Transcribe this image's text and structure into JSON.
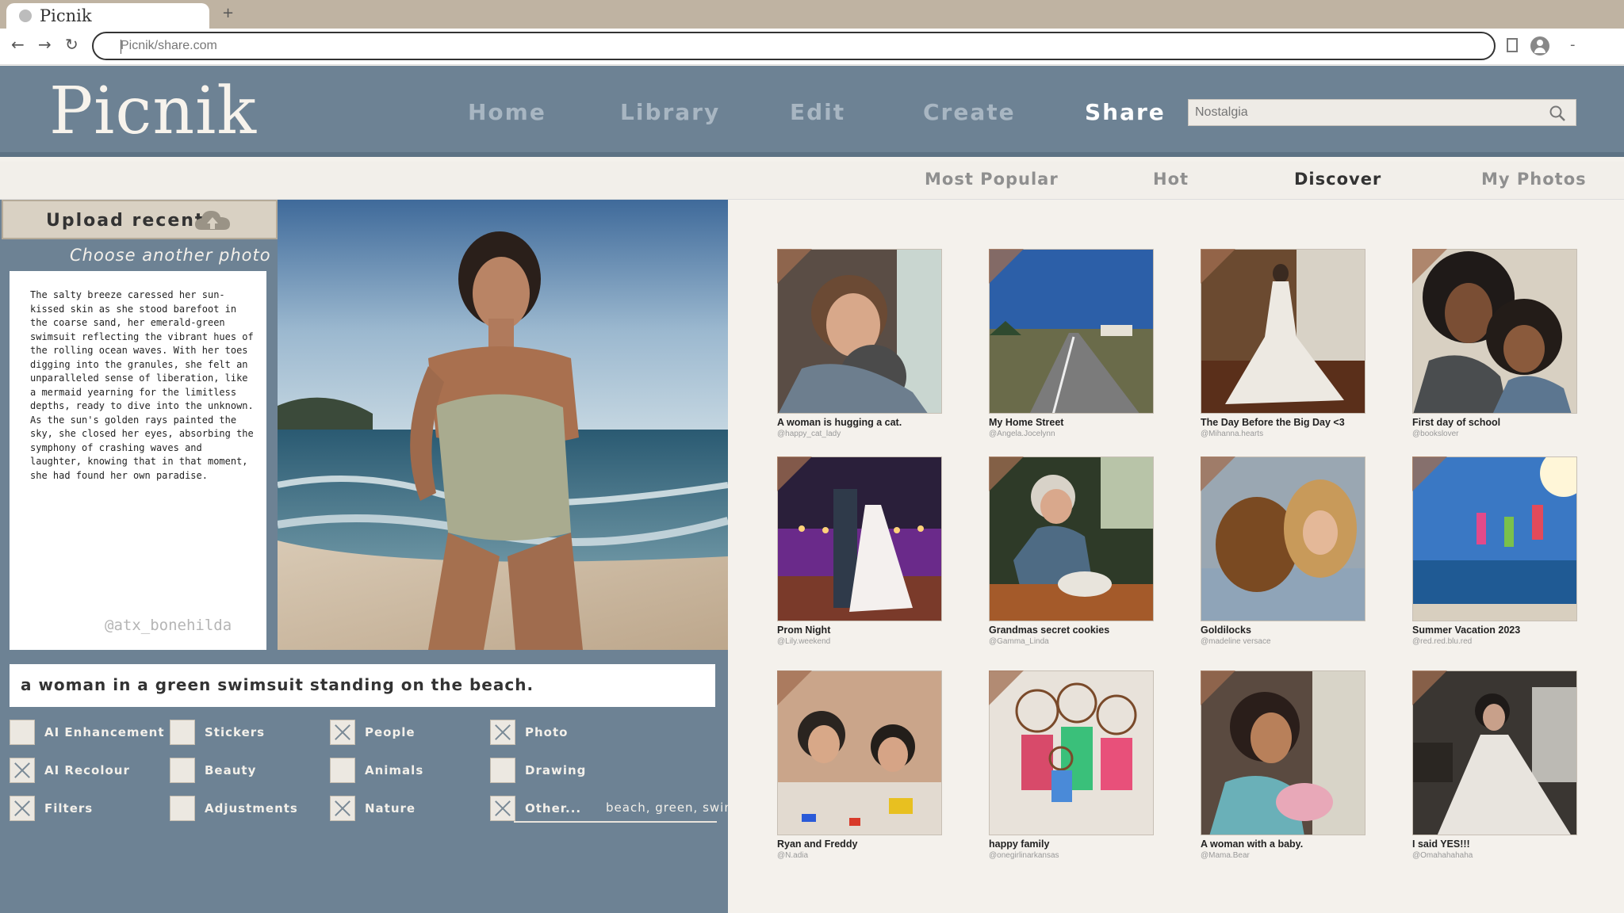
{
  "browser": {
    "tab_title": "Picnik",
    "new_tab_symbol": "+",
    "url": "Picnik/share.com",
    "back_symbol": "←",
    "forward_symbol": "→",
    "reload_symbol": "↻",
    "menu_symbol": "-"
  },
  "header": {
    "logo": "Picnik",
    "nav": [
      "Home",
      "Library",
      "Edit",
      "Create",
      "Share"
    ],
    "active_nav": "Share",
    "search_placeholder": "Nostalgia"
  },
  "subnav": {
    "items": [
      "Most Popular",
      "Hot",
      "Discover",
      "My Photos"
    ],
    "active": "Discover"
  },
  "left": {
    "upload_label": "Upload recent",
    "choose_label": "Choose another photo",
    "story": "The salty breeze caressed her sun-kissed skin as she stood barefoot in the coarse sand, her emerald-green swimsuit reflecting the vibrant hues of the rolling ocean waves. With her toes digging into the granules, she felt an unparalleled sense of liberation, like a mermaid yearning for the limitless depths, ready to dive into the unknown. As the sun's golden rays painted the sky, she closed her eyes, absorbing the symphony of crashing waves and laughter, knowing that in that moment, she had found her own paradise.",
    "handle": "@atx_bonehilda",
    "caption": "a woman in a green swimsuit standing on the beach.",
    "options": [
      {
        "label": "AI Enhancement",
        "checked": false
      },
      {
        "label": "Stickers",
        "checked": false
      },
      {
        "label": "People",
        "checked": true
      },
      {
        "label": "Photo",
        "checked": true
      },
      {
        "label": "AI Recolour",
        "checked": true
      },
      {
        "label": "Beauty",
        "checked": false
      },
      {
        "label": "Animals",
        "checked": false
      },
      {
        "label": "Drawing",
        "checked": false
      },
      {
        "label": "Filters",
        "checked": true
      },
      {
        "label": "Adjustments",
        "checked": false
      },
      {
        "label": "Nature",
        "checked": true
      },
      {
        "label": "Other...",
        "checked": true
      }
    ],
    "other_text": "beach, green, swim"
  },
  "gallery": [
    {
      "title": "A woman is hugging a cat.",
      "user": "@happy_cat_lady",
      "icon": "woman-cat-photo"
    },
    {
      "title": "My Home Street",
      "user": "@Angela.Jocelynn",
      "icon": "street-photo"
    },
    {
      "title": "The Day Before the Big Day <3",
      "user": "@Mihanna.hearts",
      "icon": "wedding-dress-photo"
    },
    {
      "title": "First day of school",
      "user": "@bookslover",
      "icon": "mother-child-photo"
    },
    {
      "title": "Prom Night",
      "user": "@Lily.weekend",
      "icon": "dancing-couple-photo"
    },
    {
      "title": "Grandmas secret cookies",
      "user": "@Gamma_Linda",
      "icon": "baking-photo"
    },
    {
      "title": "Goldilocks",
      "user": "@madeline versace",
      "icon": "woman-dog-photo"
    },
    {
      "title": "Summer Vacation 2023",
      "user": "@red.red.blu.red",
      "icon": "beach-jump-photo"
    },
    {
      "title": "Ryan and Freddy",
      "user": "@N.adia",
      "icon": "kids-playing-photo"
    },
    {
      "title": "happy family",
      "user": "@onegirlinarkansas",
      "icon": "family-drawing-photo"
    },
    {
      "title": "A woman with a baby.",
      "user": "@Mama.Bear",
      "icon": "woman-baby-photo"
    },
    {
      "title": "I said YES!!!",
      "user": "@Omahahahaha",
      "icon": "bride-photo"
    }
  ]
}
